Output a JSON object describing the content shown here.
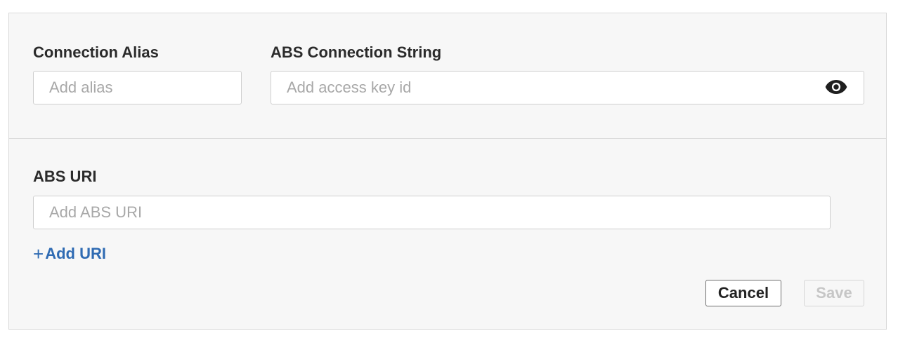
{
  "connection_alias": {
    "label": "Connection Alias",
    "placeholder": "Add alias",
    "value": ""
  },
  "connection_string": {
    "label": "ABS Connection String",
    "placeholder": "Add access key id",
    "value": "",
    "toggle_icon": "eye-icon"
  },
  "uri": {
    "label": "ABS URI",
    "placeholder": "Add ABS URI",
    "value": "",
    "add_label": "Add URI",
    "add_icon": "plus-icon"
  },
  "actions": {
    "cancel_label": "Cancel",
    "save_label": "Save",
    "save_enabled": false
  },
  "colors": {
    "link": "#2f6bb3",
    "panel_bg": "#f7f7f7",
    "border": "#d9d9d9"
  }
}
